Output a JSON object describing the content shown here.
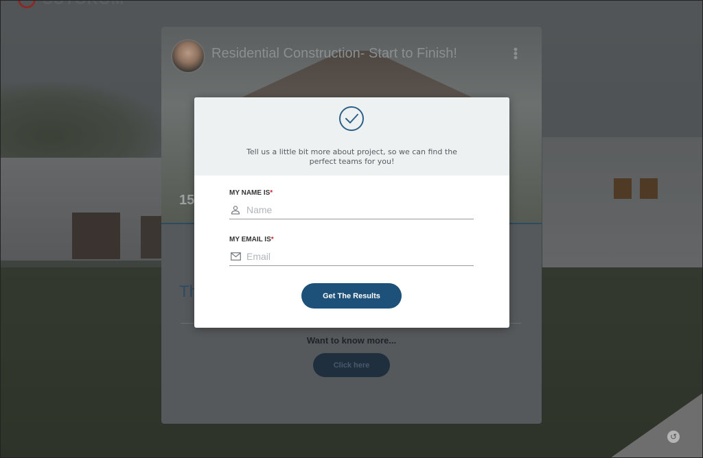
{
  "logo": {
    "text": "SUTOKOM"
  },
  "card": {
    "title": "Residential Construction- Start to Finish!",
    "number_peek": "15",
    "heading_peek": "Th",
    "want_more": "Want to know more...",
    "click_here": "Click here"
  },
  "modal": {
    "subtitle": "Tell us a little bit more about project, so we can find the perfect teams for you!",
    "name_label": "MY NAME IS",
    "name_placeholder": "Name",
    "name_value": "",
    "email_label": "MY EMAIL IS",
    "email_placeholder": "Email",
    "email_value": "",
    "required_marker": "*",
    "submit_label": "Get The Results"
  },
  "colors": {
    "accent": "#1d5179",
    "required": "#d0212b",
    "modal_header": "#edf1f2"
  },
  "icons": {
    "check": "check-circle-icon",
    "person": "person-icon",
    "mail": "mail-icon",
    "menu": "kebab-menu-icon",
    "refresh": "refresh-icon"
  }
}
